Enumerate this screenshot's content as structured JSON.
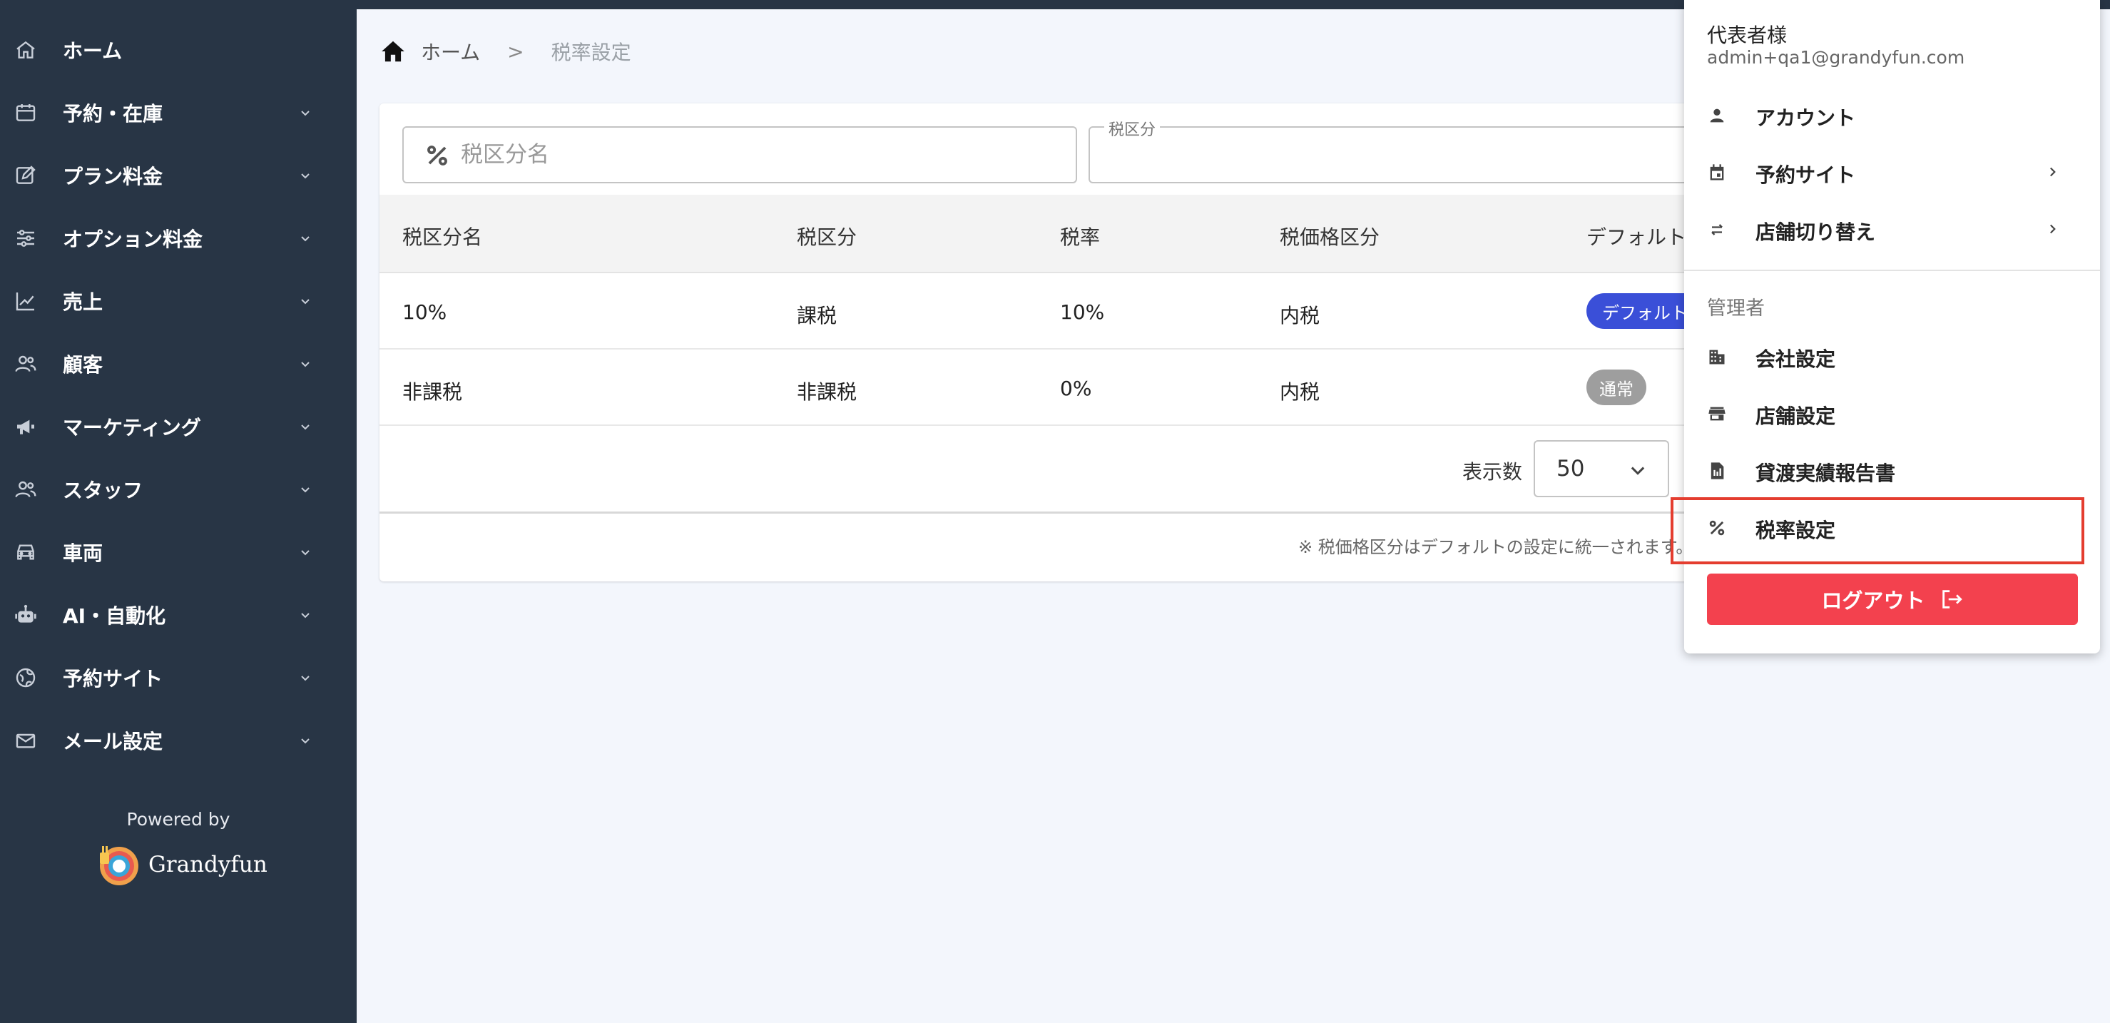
{
  "colors": {
    "sidebar_bg": "#283545",
    "accent_blue": "#3a4fd8",
    "logout_red": "#f3414e",
    "highlight_red": "#e43d2f"
  },
  "sidebar": {
    "items": [
      {
        "label": "ホーム",
        "icon": "home-icon",
        "has_submenu": false
      },
      {
        "label": "予約・在庫",
        "icon": "calendar-icon",
        "has_submenu": true
      },
      {
        "label": "プラン料金",
        "icon": "edit-icon",
        "has_submenu": true
      },
      {
        "label": "オプション料金",
        "icon": "sliders-icon",
        "has_submenu": true
      },
      {
        "label": "売上",
        "icon": "chart-line-icon",
        "has_submenu": true
      },
      {
        "label": "顧客",
        "icon": "users-icon",
        "has_submenu": true
      },
      {
        "label": "マーケティング",
        "icon": "megaphone-icon",
        "has_submenu": true
      },
      {
        "label": "スタッフ",
        "icon": "staff-icon",
        "has_submenu": true
      },
      {
        "label": "車両",
        "icon": "car-icon",
        "has_submenu": true
      },
      {
        "label": "AI・自動化",
        "icon": "robot-icon",
        "has_submenu": true
      },
      {
        "label": "予約サイト",
        "icon": "globe-icon",
        "has_submenu": true
      },
      {
        "label": "メール設定",
        "icon": "mail-icon",
        "has_submenu": true
      }
    ],
    "powered_by": "Powered by",
    "brand": "Grandyfun"
  },
  "breadcrumb": {
    "home": "ホーム",
    "separator": ">",
    "current": "税率設定"
  },
  "filters": {
    "search_placeholder": "税区分名",
    "search_value": "",
    "category_label": "税区分",
    "category_value": ""
  },
  "table": {
    "headers": [
      "税区分名",
      "税区分",
      "税率",
      "税価格区分",
      "デフォルト"
    ],
    "rows": [
      {
        "name": "10%",
        "category": "課税",
        "rate": "10%",
        "price_type": "内税",
        "badge": "デフォルト",
        "badge_type": "default"
      },
      {
        "name": "非課税",
        "category": "非課税",
        "rate": "0%",
        "price_type": "内税",
        "badge": "通常",
        "badge_type": "normal"
      }
    ]
  },
  "pagination": {
    "per_page_label": "表示数",
    "per_page_value": "50"
  },
  "note": "※ 税価格区分はデフォルトの設定に統一されます。",
  "user_menu": {
    "name": "代表者様",
    "email": "admin+qa1@grandyfun.com",
    "items": [
      {
        "label": "アカウント",
        "icon": "person-icon",
        "has_submenu": false
      },
      {
        "label": "予約サイト",
        "icon": "calendar-icon",
        "has_submenu": true
      },
      {
        "label": "店舗切り替え",
        "icon": "swap-icon",
        "has_submenu": true
      }
    ],
    "admin_section_label": "管理者",
    "admin_items": [
      {
        "label": "会社設定",
        "icon": "building-icon"
      },
      {
        "label": "店舗設定",
        "icon": "store-icon"
      },
      {
        "label": "貸渡実績報告書",
        "icon": "report-icon"
      },
      {
        "label": "税率設定",
        "icon": "percent-icon",
        "highlighted": true
      }
    ],
    "logout_label": "ログアウト"
  }
}
